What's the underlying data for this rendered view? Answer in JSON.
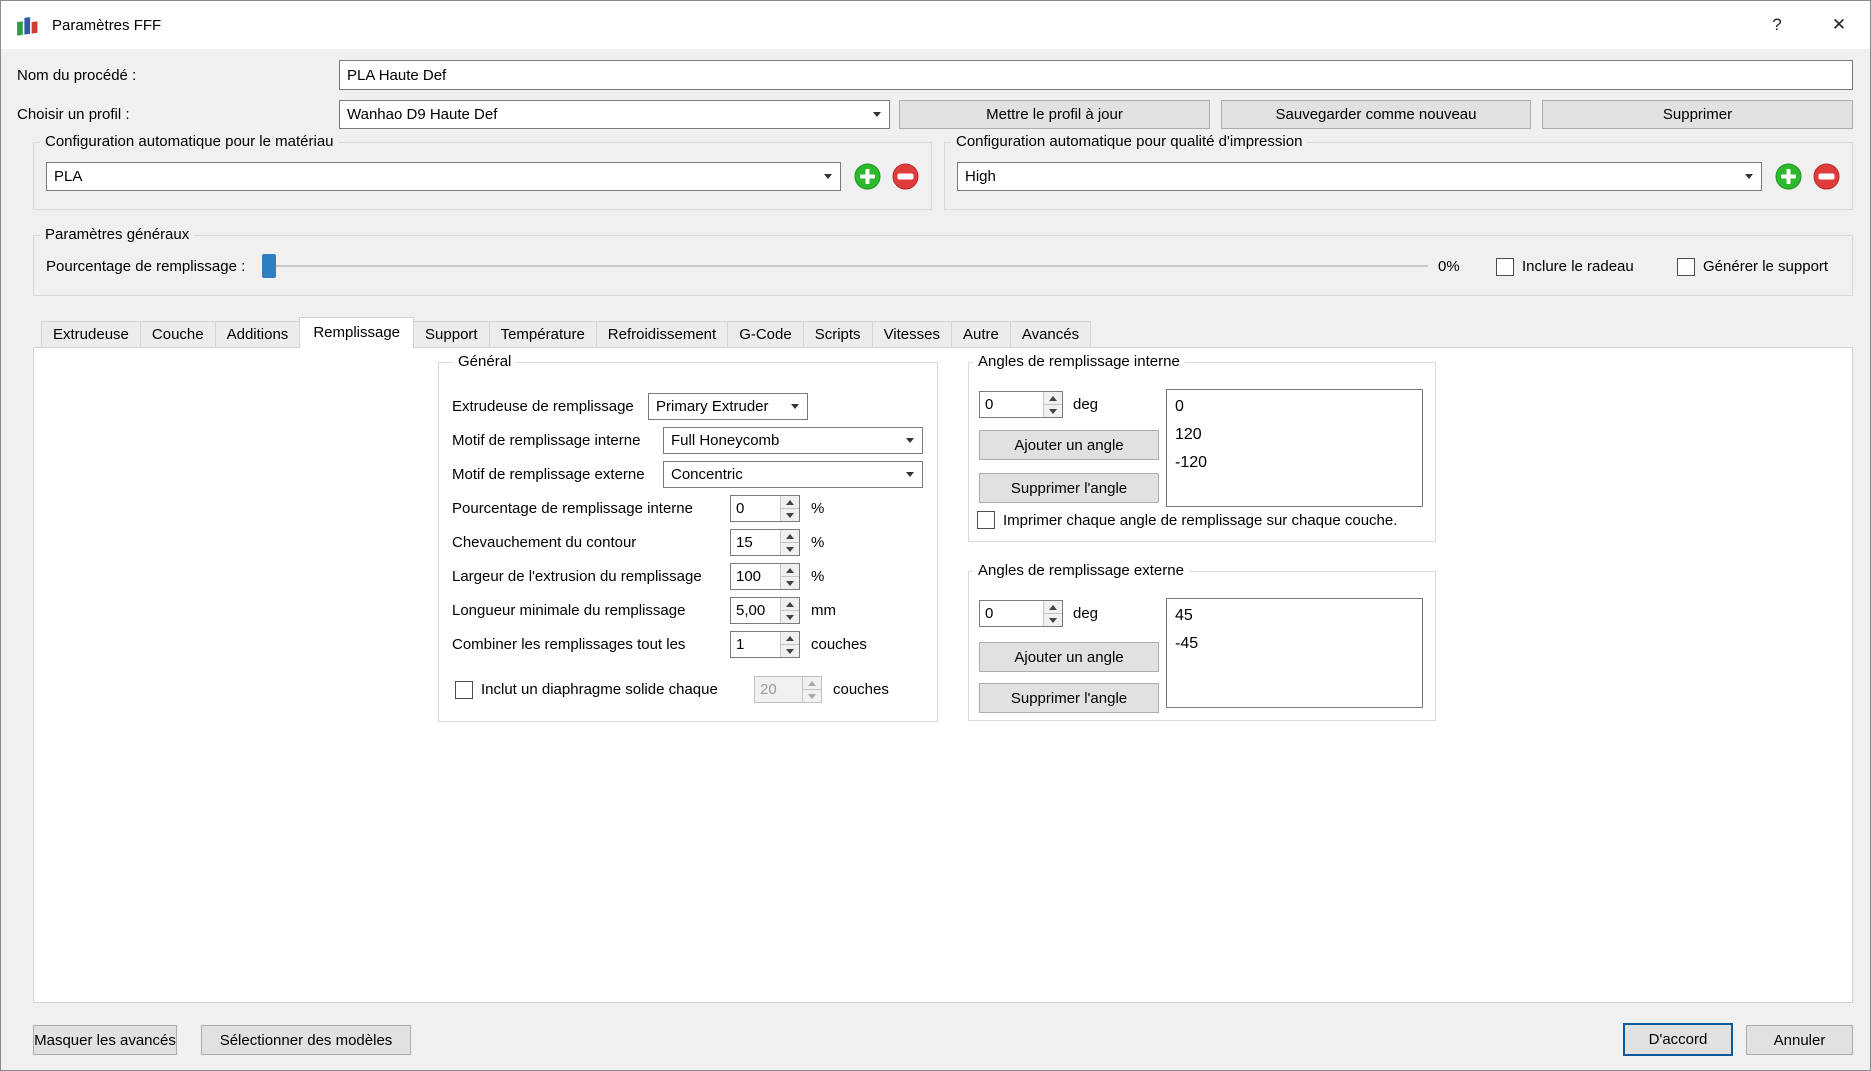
{
  "window": {
    "title": "Paramètres FFF",
    "help": "?",
    "close": "✕"
  },
  "colors": {
    "slider_handle": "#2e7fc2",
    "add_green": "#2db82d",
    "remove_red": "#e03c3c",
    "focus_blue": "#0b5a9e"
  },
  "header": {
    "process_name_label": "Nom du procédé :",
    "process_name_value": "PLA Haute Def",
    "profile_label": "Choisir un profil :",
    "profile_value": "Wanhao D9 Haute Def",
    "update_button": "Mettre le profil à jour",
    "save_new_button": "Sauvegarder comme nouveau",
    "delete_button": "Supprimer"
  },
  "auto_config": {
    "material_title": "Configuration automatique pour le matériau",
    "material_value": "PLA",
    "quality_title": "Configuration automatique pour qualité d'impression",
    "quality_value": "High"
  },
  "general": {
    "title": "Paramètres généraux",
    "infill_label": "Pourcentage de remplissage :",
    "infill_percent": "0%",
    "raft_label": "Inclure le radeau",
    "support_label": "Générer le support"
  },
  "tabs": {
    "items": [
      "Extrudeuse",
      "Couche",
      "Additions",
      "Remplissage",
      "Support",
      "Température",
      "Refroidissement",
      "G-Code",
      "Scripts",
      "Vitesses",
      "Autre",
      "Avancés"
    ],
    "active": "Remplissage"
  },
  "infill": {
    "general_group": {
      "title": "Général",
      "extruder_label": "Extrudeuse de remplissage",
      "extruder_value": "Primary Extruder",
      "internal_pattern_label": "Motif de remplissage interne",
      "internal_pattern_value": "Full Honeycomb",
      "external_pattern_label": "Motif de remplissage externe",
      "external_pattern_value": "Concentric",
      "infill_pct_label": "Pourcentage de remplissage interne",
      "infill_pct_value": "0",
      "infill_pct_unit": "%",
      "outline_overlap_label": "Chevauchement du contour",
      "outline_overlap_value": "15",
      "outline_overlap_unit": "%",
      "extrusion_width_label": "Largeur de l'extrusion du remplissage",
      "extrusion_width_value": "100",
      "extrusion_width_unit": "%",
      "min_length_label": "Longueur minimale du remplissage",
      "min_length_value": "5,00",
      "min_length_unit": "mm",
      "combine_label": "Combiner les remplissages tout les",
      "combine_value": "1",
      "combine_unit": "couches",
      "diaphragm_label": "Inclut un diaphragme solide chaque",
      "diaphragm_value": "20",
      "diaphragm_unit": "couches"
    },
    "internal_angles": {
      "title": "Angles de remplissage interne",
      "angle_value": "0",
      "angle_unit": "deg",
      "add_button": "Ajouter un angle",
      "remove_button": "Supprimer l'angle",
      "values": [
        "0",
        "120",
        "-120"
      ],
      "per_layer_label": "Imprimer chaque angle de remplissage sur chaque couche."
    },
    "external_angles": {
      "title": "Angles de remplissage externe",
      "angle_value": "0",
      "angle_unit": "deg",
      "add_button": "Ajouter un angle",
      "remove_button": "Supprimer l'angle",
      "values": [
        "45",
        "-45"
      ]
    }
  },
  "footer": {
    "hide_advanced": "Masquer les avancés",
    "select_models": "Sélectionner des modèles",
    "ok": "D'accord",
    "cancel": "Annuler"
  }
}
